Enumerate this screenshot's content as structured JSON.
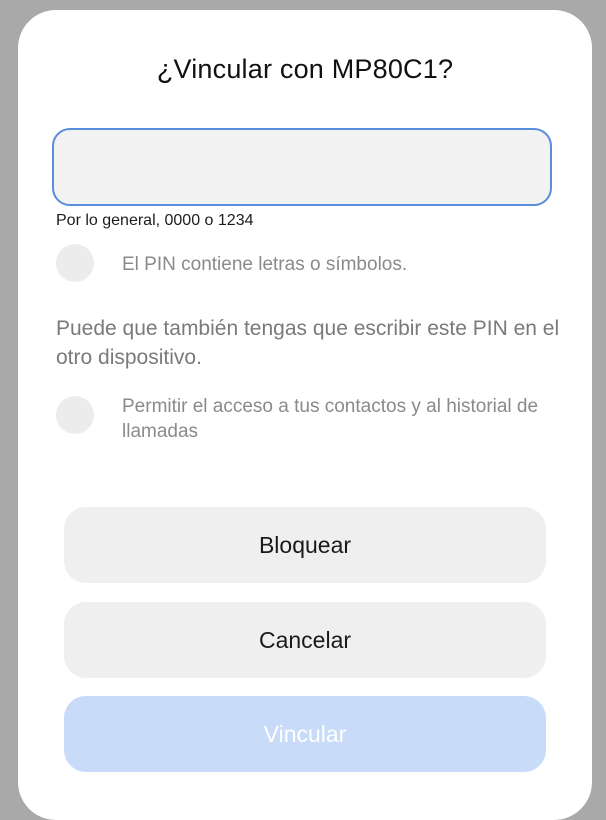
{
  "dialog": {
    "title": "¿Vincular con MP80C1?",
    "pin_input": {
      "value": "",
      "placeholder": ""
    },
    "hint": "Por lo general, 0000 o 1234",
    "pin_letters_option": {
      "label": "El PIN contiene letras o símbolos.",
      "checked": false
    },
    "note": "Puede que también tengas que escribir este PIN en el otro dispositivo.",
    "contacts_option": {
      "label": "Permitir el acceso a tus contactos y al historial de llamadas",
      "checked": false
    },
    "buttons": {
      "block_label": "Bloquear",
      "cancel_label": "Cancelar",
      "pair_label": "Vincular"
    }
  },
  "colors": {
    "accent": "#5a8cdc",
    "pair_button_disabled": "#c8dbf8",
    "button_background": "#efefef",
    "scrim": "#a9a9a9"
  }
}
